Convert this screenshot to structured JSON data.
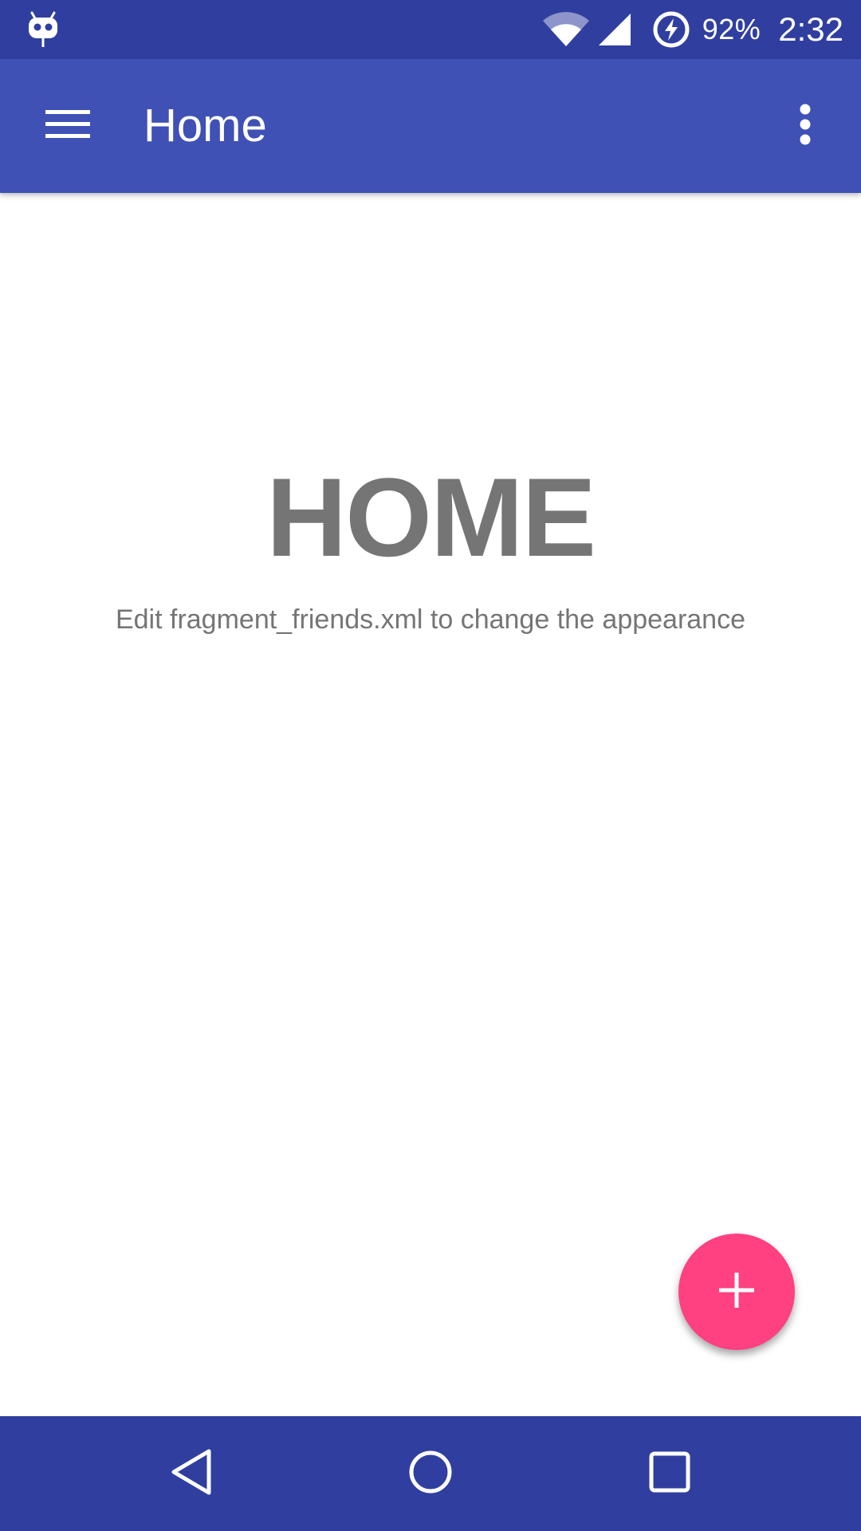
{
  "status_bar": {
    "notification_icon": "cyanogenmod-mascot-icon",
    "wifi_icon": "wifi-icon",
    "signal_icon": "cell-signal-icon",
    "battery_icon": "battery-charging-icon",
    "battery_percent": "92%",
    "time": "2:32"
  },
  "app_bar": {
    "menu_icon": "hamburger-menu-icon",
    "title": "Home",
    "overflow_icon": "more-vert-icon"
  },
  "main": {
    "heading": "HOME",
    "subtitle": "Edit fragment_friends.xml to change the appearance"
  },
  "fab": {
    "icon": "add-icon"
  },
  "nav_bar": {
    "back_icon": "back-triangle-icon",
    "home_icon": "home-circle-icon",
    "recents_icon": "recents-square-icon"
  },
  "colors": {
    "status_bar": "#303f9f",
    "app_bar": "#3f51b5",
    "accent": "#ff4081",
    "text_secondary": "#757575"
  }
}
